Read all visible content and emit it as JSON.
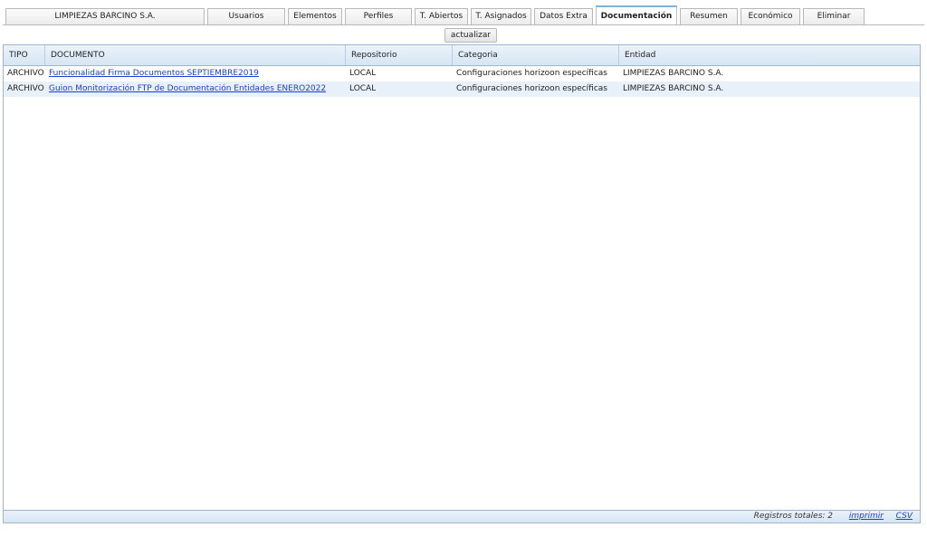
{
  "tabs": [
    {
      "label": "LIMPIEZAS BARCINO S.A.",
      "name": "tab-entidad",
      "active": false
    },
    {
      "label": "Usuarios",
      "name": "tab-usuarios",
      "active": false
    },
    {
      "label": "Elementos",
      "name": "tab-elementos",
      "active": false
    },
    {
      "label": "Perfiles",
      "name": "tab-perfiles",
      "active": false
    },
    {
      "label": "T. Abiertos",
      "name": "tab-t-abiertos",
      "active": false
    },
    {
      "label": "T. Asignados",
      "name": "tab-t-asignados",
      "active": false
    },
    {
      "label": "Datos Extra",
      "name": "tab-datos-extra",
      "active": false
    },
    {
      "label": "Documentación",
      "name": "tab-documentacion",
      "active": true
    },
    {
      "label": "Resumen",
      "name": "tab-resumen",
      "active": false
    },
    {
      "label": "Económico",
      "name": "tab-economico",
      "active": false
    },
    {
      "label": "Eliminar",
      "name": "tab-eliminar",
      "active": false
    }
  ],
  "toolbar": {
    "refresh_label": "actualizar"
  },
  "table": {
    "columns": [
      "TIPO",
      "DOCUMENTO",
      "Repositorio",
      "Categoria",
      "Entidad"
    ],
    "rows": [
      {
        "tipo": "ARCHIVO",
        "documento": "Funcionalidad Firma Documentos SEPTIEMBRE2019",
        "repositorio": "LOCAL",
        "categoria": "Configuraciones horizoon específicas",
        "entidad": "LIMPIEZAS BARCINO S.A."
      },
      {
        "tipo": "ARCHIVO",
        "documento": "Guion Monitorización FTP de Documentación Entidades ENERO2022",
        "repositorio": "LOCAL",
        "categoria": "Configuraciones horizoon específicas",
        "entidad": "LIMPIEZAS BARCINO S.A."
      }
    ]
  },
  "footer": {
    "total_label": "Registros totales: 2",
    "print_label": "imprimir",
    "csv_label": "CSV"
  },
  "colors": {
    "accent": "#7fb2d8",
    "link": "#1a3fd6",
    "header_bg": "#d6e6f4",
    "alt_row": "#e8f1fa"
  }
}
